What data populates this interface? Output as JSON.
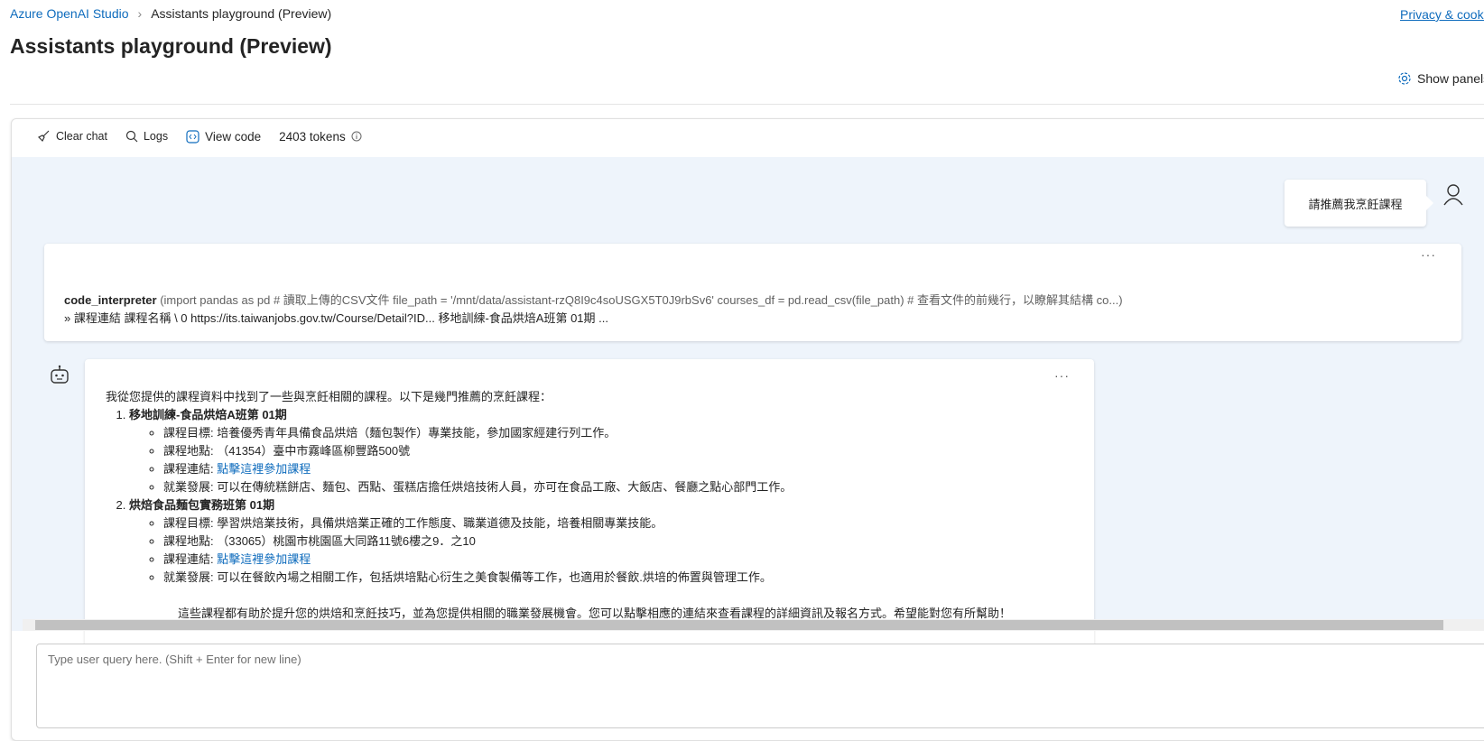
{
  "breadcrumb": {
    "root": "Azure OpenAI Studio",
    "current": "Assistants playground (Preview)"
  },
  "page_title": "Assistants playground (Preview)",
  "privacy_link": "Privacy & cookies",
  "show_panels": "Show panels",
  "toolbar": {
    "clear_chat": "Clear chat",
    "logs": "Logs",
    "view_code": "View code",
    "tokens": "2403 tokens"
  },
  "user_message": "請推薦我烹飪課程",
  "code_call": {
    "tool": "code_interpreter",
    "args": "(import pandas as pd # 讀取上傳的CSV文件 file_path = '/mnt/data/assistant-rzQ8I9c4soUSGX5T0J9rbSv6' courses_df = pd.read_csv(file_path) # 查看文件的前幾行，以瞭解其結構 co...)",
    "output": "» 課程連結 課程名稱 \\ 0 https://its.taiwanjobs.gov.tw/Course/Detail?ID... 移地訓練-食品烘焙A班第 01期 ..."
  },
  "assistant": {
    "intro": "我從您提供的課程資料中找到了一些與烹飪相關的課程。以下是幾門推薦的烹飪課程：",
    "courses": [
      {
        "name": "移地訓練-食品烘焙A班第 01期",
        "items": [
          {
            "label": "課程目標:",
            "text": " 培養優秀青年具備食品烘焙（麵包製作）專業技能，參加國家經建行列工作。"
          },
          {
            "label": "課程地點:",
            "text": " （41354）臺中市霧峰區柳豐路500號"
          },
          {
            "label": "課程連結:",
            "link": "點擊這裡參加課程"
          },
          {
            "label": "就業發展:",
            "text": " 可以在傳統糕餅店、麵包、西點、蛋糕店擔任烘焙技術人員，亦可在食品工廠、大飯店、餐廳之點心部門工作。"
          }
        ]
      },
      {
        "name": "烘焙食品麵包實務班第 01期",
        "items": [
          {
            "label": "課程目標:",
            "text": " 學習烘焙業技術，具備烘焙業正確的工作態度、職業道德及技能，培養相關專業技能。"
          },
          {
            "label": "課程地點:",
            "text": " （33065）桃園市桃園區大同路11號6樓之9．之10"
          },
          {
            "label": "課程連結:",
            "link": "點擊這裡參加課程"
          },
          {
            "label": "就業發展:",
            "text": " 可以在餐飲內場之相關工作，包括烘培點心衍生之美食製備等工作，也適用於餐飲.烘培的佈置與管理工作。"
          }
        ]
      }
    ],
    "closing": "這些課程都有助於提升您的烘焙和烹飪技巧，並為您提供相關的職業發展機會。您可以點擊相應的連結來查看課程的詳細資訊及報名方式。希望能對您有所幫助！"
  },
  "input": {
    "placeholder": "Type user query here. (Shift + Enter for new line)"
  },
  "colors": {
    "accent": "#0f6cbd",
    "chat_bg": "#eef4fb"
  }
}
